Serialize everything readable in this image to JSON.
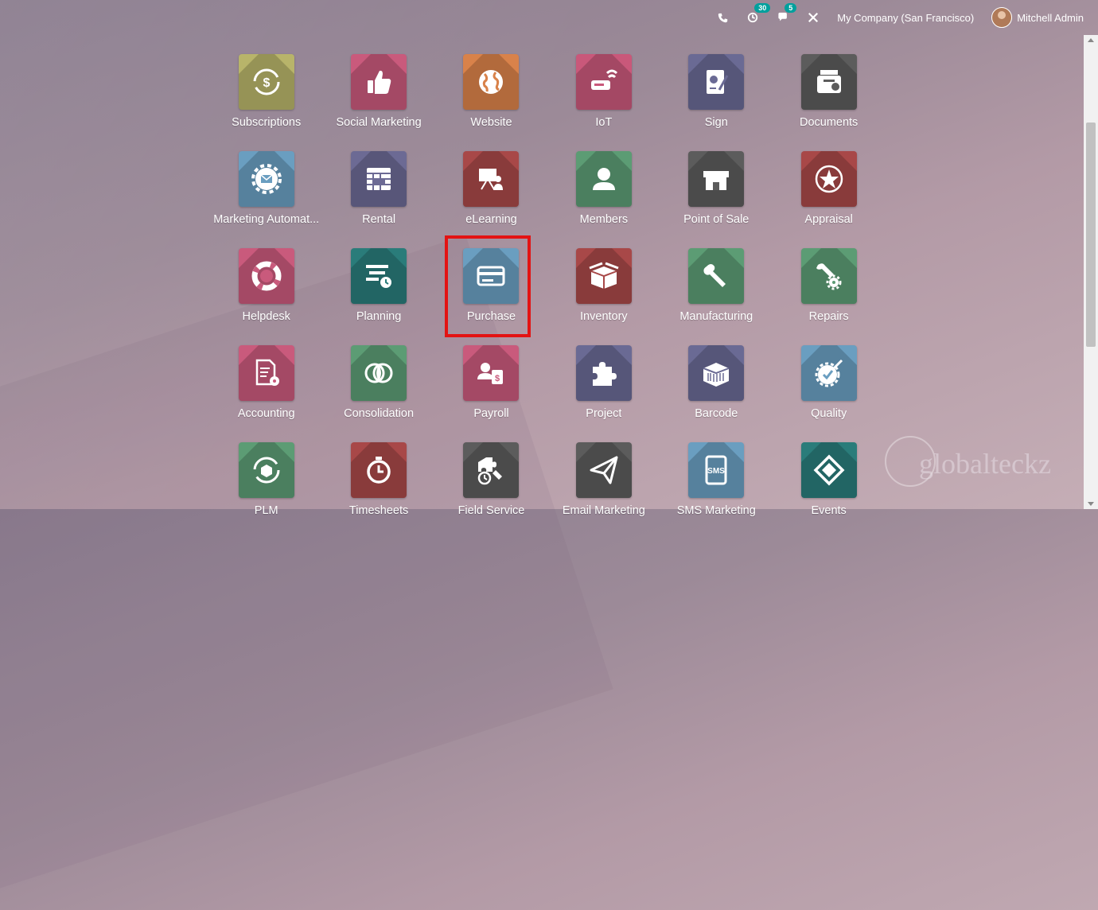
{
  "topbar": {
    "activity_count": "30",
    "messages_count": "5",
    "company": "My Company (San Francisco)",
    "user": "Mitchell Admin",
    "icons": [
      "phone-icon",
      "activity-icon",
      "chat-icon",
      "tools-icon"
    ]
  },
  "apps": [
    {
      "label": "Subscriptions",
      "color": "#b8b46a",
      "icon": "subscriptions-icon"
    },
    {
      "label": "Social Marketing",
      "color": "#c95a7c",
      "icon": "thumbs-up-icon"
    },
    {
      "label": "Website",
      "color": "#d9824a",
      "icon": "globe-icon"
    },
    {
      "label": "IoT",
      "color": "#c9587a",
      "icon": "iot-icon"
    },
    {
      "label": "Sign",
      "color": "#6a6a94",
      "icon": "sign-icon"
    },
    {
      "label": "Documents",
      "color": "#5c5c5c",
      "icon": "documents-icon"
    },
    {
      "label": "Marketing Automat...",
      "color": "#6a9ec0",
      "icon": "gear-mail-icon"
    },
    {
      "label": "Rental",
      "color": "#6c6a94",
      "icon": "calendar-grid-icon"
    },
    {
      "label": "eLearning",
      "color": "#a84848",
      "icon": "teacher-icon"
    },
    {
      "label": "Members",
      "color": "#5c9c74",
      "icon": "user-icon"
    },
    {
      "label": "Point of Sale",
      "color": "#5c5c5c",
      "icon": "shop-icon"
    },
    {
      "label": "Appraisal",
      "color": "#a84848",
      "icon": "star-icon"
    },
    {
      "label": "Helpdesk",
      "color": "#c95a7c",
      "icon": "lifebuoy-icon"
    },
    {
      "label": "Planning",
      "color": "#2a7c7a",
      "icon": "planning-icon"
    },
    {
      "label": "Purchase",
      "color": "#6a9ec0",
      "icon": "credit-card-icon"
    },
    {
      "label": "Inventory",
      "color": "#a84848",
      "icon": "box-icon"
    },
    {
      "label": "Manufacturing",
      "color": "#5c9c74",
      "icon": "wrench-icon"
    },
    {
      "label": "Repairs",
      "color": "#5c9c74",
      "icon": "repair-gears-icon"
    },
    {
      "label": "Accounting",
      "color": "#c95a7c",
      "icon": "accounting-icon"
    },
    {
      "label": "Consolidation",
      "color": "#5c9c74",
      "icon": "circles-icon"
    },
    {
      "label": "Payroll",
      "color": "#c95a7c",
      "icon": "payroll-icon"
    },
    {
      "label": "Project",
      "color": "#6a6a94",
      "icon": "puzzle-icon"
    },
    {
      "label": "Barcode",
      "color": "#6a6a94",
      "icon": "barcode-box-icon"
    },
    {
      "label": "Quality",
      "color": "#6a9ec0",
      "icon": "quality-icon"
    },
    {
      "label": "PLM",
      "color": "#5c9c74",
      "icon": "plm-icon"
    },
    {
      "label": "Timesheets",
      "color": "#a84848",
      "icon": "stopwatch-icon"
    },
    {
      "label": "Field Service",
      "color": "#5c5c5c",
      "icon": "field-service-icon"
    },
    {
      "label": "Email Marketing",
      "color": "#5c5c5c",
      "icon": "paper-plane-icon"
    },
    {
      "label": "SMS Marketing",
      "color": "#6a9ec0",
      "icon": "sms-icon"
    },
    {
      "label": "Events",
      "color": "#2a7c7a",
      "icon": "ticket-icon"
    }
  ],
  "watermark": "globalteckz"
}
